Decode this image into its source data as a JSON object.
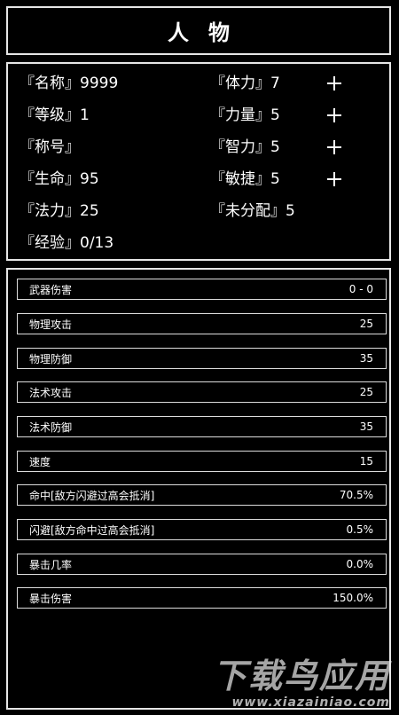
{
  "header": {
    "title": "人物"
  },
  "info": {
    "left": [
      {
        "label": "『名称』",
        "value": "9999"
      },
      {
        "label": "『等级』",
        "value": "1"
      },
      {
        "label": "『称号』",
        "value": ""
      },
      {
        "label": "『生命』",
        "value": "95"
      },
      {
        "label": "『法力』",
        "value": "25"
      },
      {
        "label": "『经验』",
        "value": "0/13"
      }
    ],
    "right": [
      {
        "label": "『体力』",
        "value": "7"
      },
      {
        "label": "『力量』",
        "value": "5"
      },
      {
        "label": "『智力』",
        "value": "5"
      },
      {
        "label": "『敏捷』",
        "value": "5"
      },
      {
        "label": "『未分配』",
        "value": "5"
      }
    ],
    "plus_icon": "plus-icon"
  },
  "stats": [
    {
      "label": "武器伤害",
      "value": "0 - 0"
    },
    {
      "label": "物理攻击",
      "value": "25"
    },
    {
      "label": "物理防御",
      "value": "35"
    },
    {
      "label": "法术攻击",
      "value": "25"
    },
    {
      "label": "法术防御",
      "value": "35"
    },
    {
      "label": "速度",
      "value": "15"
    },
    {
      "label": "命中[敌方闪避过高会抵消]",
      "value": "70.5%"
    },
    {
      "label": "闪避[敌方命中过高会抵消]",
      "value": "0.5%"
    },
    {
      "label": "暴击几率",
      "value": "0.0%"
    },
    {
      "label": "暴击伤害",
      "value": "150.0%"
    }
  ],
  "watermark": {
    "main": "下载鸟应用",
    "sub": "www.xiazainiao.com"
  }
}
